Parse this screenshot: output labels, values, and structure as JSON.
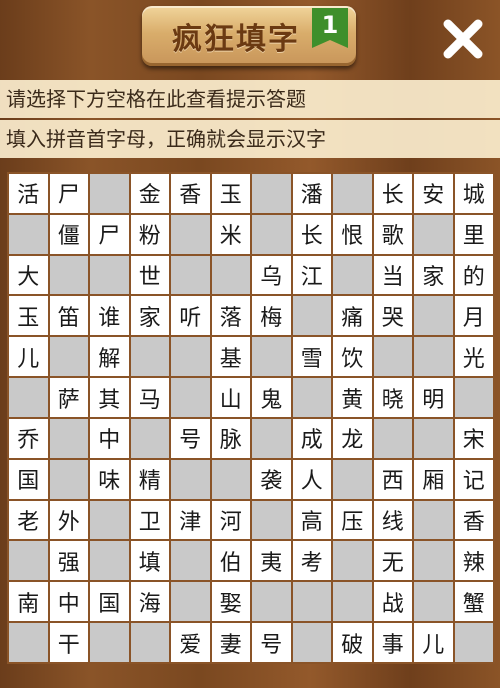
{
  "header": {
    "title": "疯狂填字",
    "level": "1",
    "close_icon": "close-x-icon"
  },
  "hints": {
    "line1": "请选择下方空格在此查看提示答题",
    "line2": "填入拼音首字母，正确就会显示汉字"
  },
  "board": {
    "rows": [
      [
        "活",
        "尸",
        "",
        "金",
        "香",
        "玉",
        "",
        "潘",
        "",
        "长",
        "安",
        "城"
      ],
      [
        "",
        "僵",
        "尸",
        "粉",
        "",
        "米",
        "",
        "长",
        "恨",
        "歌",
        "",
        "里"
      ],
      [
        "大",
        "",
        "",
        "世",
        "",
        "",
        "乌",
        "江",
        "",
        "当",
        "家",
        "的"
      ],
      [
        "玉",
        "笛",
        "谁",
        "家",
        "听",
        "落",
        "梅",
        "",
        "痛",
        "哭",
        "",
        "月"
      ],
      [
        "儿",
        "",
        "解",
        "",
        "",
        "基",
        "",
        "雪",
        "饮",
        "",
        "",
        "光"
      ],
      [
        "",
        "萨",
        "其",
        "马",
        "",
        "山",
        "鬼",
        "",
        "黄",
        "晓",
        "明",
        ""
      ],
      [
        "乔",
        "",
        "中",
        "",
        "号",
        "脉",
        "",
        "成",
        "龙",
        "",
        "",
        "宋"
      ],
      [
        "国",
        "",
        "味",
        "精",
        "",
        "",
        "袭",
        "人",
        "",
        "西",
        "厢",
        "记"
      ],
      [
        "老",
        "外",
        "",
        "卫",
        "津",
        "河",
        "",
        "高",
        "压",
        "线",
        "",
        "香"
      ],
      [
        "",
        "强",
        "",
        "填",
        "",
        "伯",
        "夷",
        "考",
        "",
        "无",
        "",
        "辣"
      ],
      [
        "南",
        "中",
        "国",
        "海",
        "",
        "娶",
        "",
        "",
        "",
        "战",
        "",
        "蟹"
      ],
      [
        "",
        "干",
        "",
        "",
        "爱",
        "妻",
        "号",
        "",
        "破",
        "事",
        "儿",
        ""
      ]
    ]
  }
}
